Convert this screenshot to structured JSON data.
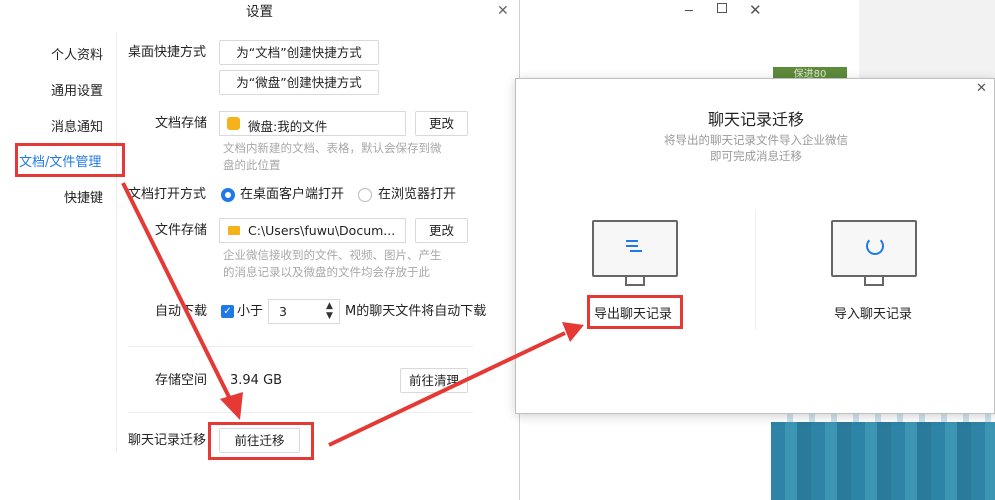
{
  "settings": {
    "title": "设置",
    "sidebar": {
      "items": [
        {
          "label": "个人资料"
        },
        {
          "label": "通用设置"
        },
        {
          "label": "消息通知"
        },
        {
          "label": "文档/文件管理"
        },
        {
          "label": "快捷键"
        }
      ]
    },
    "desktop_shortcut": {
      "label": "桌面快捷方式",
      "doc_button": "为“文档”创建快捷方式",
      "weipan_button": "为“微盘”创建快捷方式"
    },
    "doc_storage": {
      "label": "文档存储",
      "value": "微盘:我的文件",
      "change": "更改",
      "hint_line1": "文档内新建的文档、表格，默认会保存到微",
      "hint_line2": "盘的此位置"
    },
    "doc_open": {
      "label": "文档打开方式",
      "option_desktop": "在桌面客户端打开",
      "option_browser": "在浏览器打开",
      "selected": "在桌面客户端打开"
    },
    "file_storage": {
      "label": "文件存储",
      "value": "C:\\Users\\fuwu\\Docum...",
      "change": "更改",
      "hint_line1": "企业微信接收到的文件、视频、图片、产生",
      "hint_line2": "的消息记录以及微盘的文件均会存放于此"
    },
    "auto_download": {
      "label": "自动下载",
      "less_than": "小于",
      "checked": true,
      "value": "3",
      "suffix": "M的聊天文件将自动下载"
    },
    "storage_space": {
      "label": "存储空间",
      "value": "3.94 GB",
      "clean_button": "前往清理"
    },
    "chat_migration": {
      "label": "聊天记录迁移",
      "button": "前往迁移"
    }
  },
  "migration_dialog": {
    "title": "聊天记录迁移",
    "subtitle_line1": "将导出的聊天记录文件导入企业微信",
    "subtitle_line2": "即可完成消息迁移",
    "export_label": "导出聊天记录",
    "import_label": "导入聊天记录"
  },
  "background": {
    "green_text": "保进80"
  },
  "colors": {
    "accent": "#1f7ae8",
    "annotation_red": "#e53935",
    "green_bar": "#5e8a3a"
  }
}
